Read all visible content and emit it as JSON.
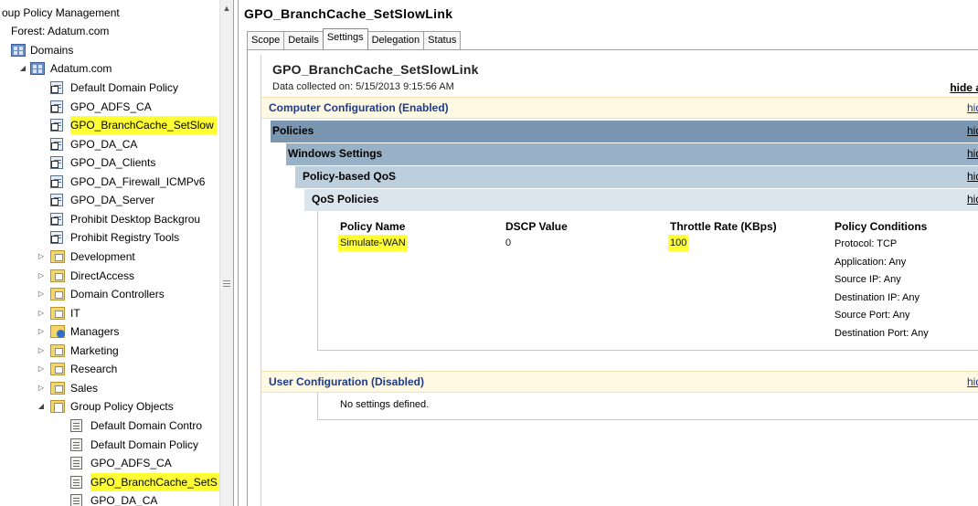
{
  "tree": {
    "root_label": "oup Policy Management",
    "forest_label": "Forest: Adatum.com",
    "domains_label": "Domains",
    "domain_label": "Adatum.com",
    "linked_gpos": [
      {
        "label": "Default Domain Policy",
        "highlighted": false
      },
      {
        "label": "GPO_ADFS_CA",
        "highlighted": false
      },
      {
        "label": "GPO_BranchCache_SetSlow",
        "highlighted": true
      },
      {
        "label": "GPO_DA_CA",
        "highlighted": false
      },
      {
        "label": "GPO_DA_Clients",
        "highlighted": false
      },
      {
        "label": "GPO_DA_Firewall_ICMPv6",
        "highlighted": false
      },
      {
        "label": "GPO_DA_Server",
        "highlighted": false
      },
      {
        "label": "Prohibit Desktop Backgrou",
        "highlighted": false
      },
      {
        "label": "Prohibit Registry Tools",
        "highlighted": false
      }
    ],
    "ous": [
      {
        "label": "Development",
        "icon": "folder-icon"
      },
      {
        "label": "DirectAccess",
        "icon": "folder-icon"
      },
      {
        "label": "Domain Controllers",
        "icon": "folder-icon"
      },
      {
        "label": "IT",
        "icon": "folder-icon"
      },
      {
        "label": "Managers",
        "icon": "managers-folder-icon"
      },
      {
        "label": "Marketing",
        "icon": "folder-icon"
      },
      {
        "label": "Research",
        "icon": "folder-icon"
      },
      {
        "label": "Sales",
        "icon": "folder-icon"
      }
    ],
    "gpo_folder_label": "Group Policy Objects",
    "gpo_objects": [
      {
        "label": "Default Domain Contro",
        "highlighted": false
      },
      {
        "label": "Default Domain Policy",
        "highlighted": false
      },
      {
        "label": "GPO_ADFS_CA",
        "highlighted": false
      },
      {
        "label": "GPO_BranchCache_SetS",
        "highlighted": true
      },
      {
        "label": "GPO_DA_CA",
        "highlighted": false
      }
    ]
  },
  "right": {
    "title": "GPO_BranchCache_SetSlowLink",
    "tabs": [
      "Scope",
      "Details",
      "Settings",
      "Delegation",
      "Status"
    ],
    "active_tab": "Settings",
    "report_title": "GPO_BranchCache_SetSlowLink",
    "data_collected": "Data collected on: 5/15/2013 9:15:56 AM",
    "hide_all": "hide a",
    "hide": "hid",
    "computer_config": "Computer Configuration (Enabled)",
    "policies": "Policies",
    "windows_settings": "Windows Settings",
    "policy_qos": "Policy-based QoS",
    "qos_policies": "QoS Policies",
    "table": {
      "headers": [
        "Policy Name",
        "DSCP Value",
        "Throttle Rate (KBps)",
        "Policy Conditions"
      ],
      "row": {
        "policy_name": "Simulate-WAN",
        "dscp": "0",
        "throttle": "100",
        "conditions": [
          "Protocol: TCP",
          "Application: Any",
          "Source IP: Any",
          "Destination IP: Any",
          "Source Port: Any",
          "Destination Port: Any"
        ]
      }
    },
    "user_config": "User Configuration (Disabled)",
    "no_settings": "No settings defined."
  },
  "colors": {
    "highlight": "#ffff33",
    "config_band": "#fff9e3",
    "policies_band": "#7a96b0",
    "windows_band": "#99b1c6",
    "qos_band": "#bdcfdd",
    "qospol_band": "#dbe5ee",
    "config_text": "#1c3a8c"
  }
}
